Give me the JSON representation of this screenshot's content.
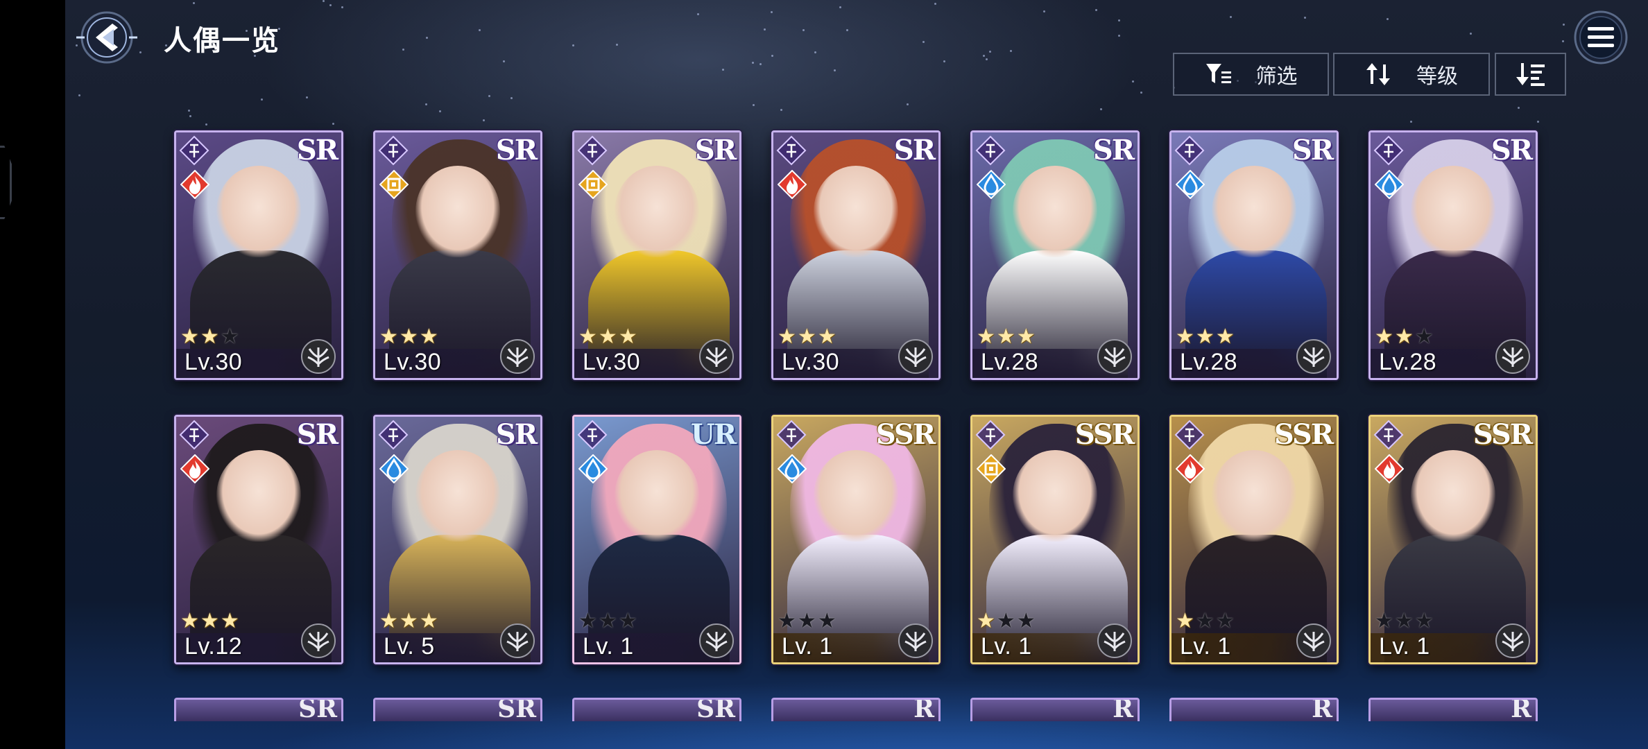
{
  "header": {
    "title": "人偶一览",
    "back_icon": "back-arrow-icon",
    "menu_icon": "hamburger-menu-icon"
  },
  "toolbar": {
    "filter_label": "筛选",
    "filter_icon": "filter-icon",
    "sort_label": "等级",
    "sort_icon": "sort-arrows-icon",
    "order_icon": "sort-descending-icon"
  },
  "colors": {
    "sr_frame": "#c7b2ee",
    "ssr_frame": "#ecd27a",
    "ur_frame": "#f0c2e6",
    "fire": "#e23a2e",
    "water": "#2a8be0",
    "light": "#e6a51e"
  },
  "cards": [
    {
      "rarity": "SR",
      "level": "Lv.30",
      "stars": 2,
      "element": "fire",
      "element_icon": "fire-element-icon",
      "hair": "#c9d2e4",
      "outfit": "#2a2a30",
      "bg": "#5b4a86"
    },
    {
      "rarity": "SR",
      "level": "Lv.30",
      "stars": 3,
      "element": "light",
      "element_icon": "light-element-icon",
      "hair": "#4a3328",
      "outfit": "#3a3a48",
      "bg": "#6a5a9a"
    },
    {
      "rarity": "SR",
      "level": "Lv.30",
      "stars": 3,
      "element": "light",
      "element_icon": "light-element-icon",
      "hair": "#f0e2b8",
      "outfit": "#f1c82a",
      "bg": "#8a7aa8"
    },
    {
      "rarity": "SR",
      "level": "Lv.30",
      "stars": 3,
      "element": "fire",
      "element_icon": "fire-element-icon",
      "hair": "#b8502a",
      "outfit": "#cfd4e0",
      "bg": "#5a4a80"
    },
    {
      "rarity": "SR",
      "level": "Lv.28",
      "stars": 3,
      "element": "water",
      "element_icon": "water-element-icon",
      "hair": "#7fc8b4",
      "outfit": "#ffffff",
      "bg": "#6a6aa8"
    },
    {
      "rarity": "SR",
      "level": "Lv.28",
      "stars": 3,
      "element": "water",
      "element_icon": "water-element-icon",
      "hair": "#b8cde8",
      "outfit": "#2e4aa8",
      "bg": "#7a7ab8"
    },
    {
      "rarity": "SR",
      "level": "Lv.28",
      "stars": 2,
      "element": "water",
      "element_icon": "water-element-icon",
      "hair": "#d6cfe8",
      "outfit": "#3a2a4a",
      "bg": "#6a5a9a"
    },
    {
      "rarity": "SR",
      "level": "Lv.12",
      "stars": 3,
      "element": "fire",
      "element_icon": "fire-element-icon",
      "hair": "#1e1a1c",
      "outfit": "#2a2628",
      "bg": "#6a4a7a"
    },
    {
      "rarity": "SR",
      "level": "Lv. 5",
      "stars": 3,
      "element": "water",
      "element_icon": "water-element-icon",
      "hair": "#d8d4cc",
      "outfit": "#d9b45a",
      "bg": "#6a6a9a"
    },
    {
      "rarity": "UR",
      "level": "Lv. 1",
      "stars": 0,
      "element": "water",
      "element_icon": "water-element-icon",
      "hair": "#f2a8bc",
      "outfit": "#1e2a44",
      "bg": "#7a9ad0"
    },
    {
      "rarity": "SSR",
      "level": "Lv. 1",
      "stars": 0,
      "element": "water",
      "element_icon": "water-element-icon",
      "hair": "#f0b8e4",
      "outfit": "#f4f0ff",
      "bg": "#c9a860"
    },
    {
      "rarity": "SSR",
      "level": "Lv. 1",
      "stars": 1,
      "element": "light",
      "element_icon": "light-element-icon",
      "hair": "#2a223a",
      "outfit": "#f4f0ff",
      "bg": "#c9a860"
    },
    {
      "rarity": "SSR",
      "level": "Lv. 1",
      "stars": 1,
      "element": "fire",
      "element_icon": "fire-element-icon",
      "hair": "#f0d8a8",
      "outfit": "#2a2226",
      "bg": "#b8904a"
    },
    {
      "rarity": "SSR",
      "level": "Lv. 1",
      "stars": 0,
      "element": "fire",
      "element_icon": "fire-element-icon",
      "hair": "#2a2430",
      "outfit": "#3a3a44",
      "bg": "#c9a860"
    }
  ],
  "peek_row": [
    {
      "rarity": "SR"
    },
    {
      "rarity": "SR"
    },
    {
      "rarity": "SR"
    },
    {
      "rarity": "R"
    },
    {
      "rarity": "R"
    },
    {
      "rarity": "R"
    },
    {
      "rarity": "R"
    }
  ]
}
